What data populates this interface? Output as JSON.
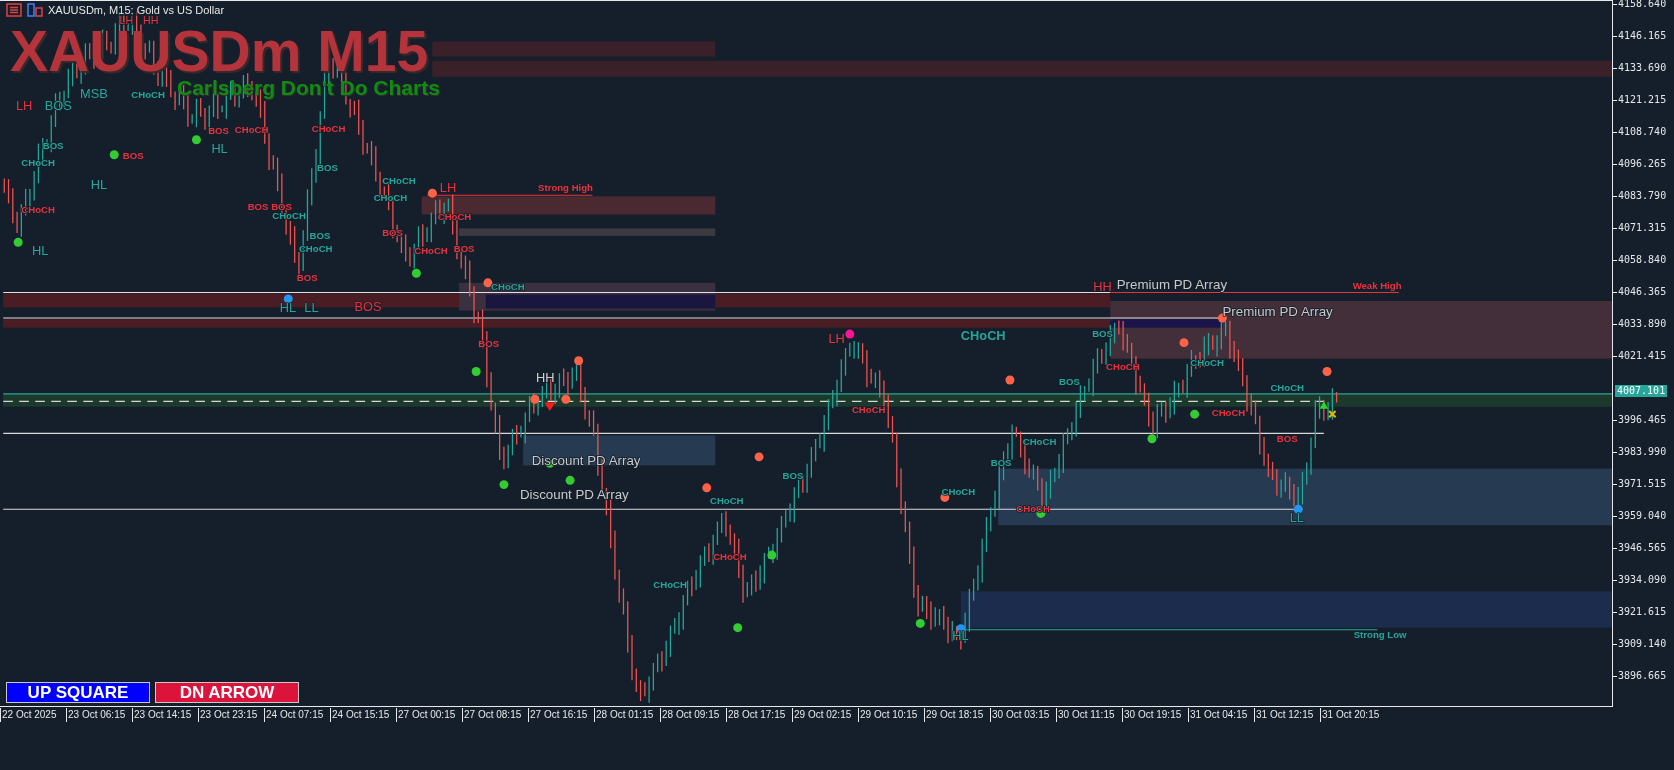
{
  "window": {
    "title": "XAUUSDm, M15: Gold vs US Dollar"
  },
  "chart": {
    "symbol_overlay": "XAUUSDm M15",
    "subtitle": "Carlsberg Don't Do Charts",
    "zone_labels": [
      {
        "text": "Strong High",
        "kind": "level",
        "color": "#e8323c"
      },
      {
        "text": "Weak High",
        "kind": "level",
        "color": "#e8323c"
      },
      {
        "text": "Premium PD Array",
        "kind": "array",
        "color": "#c8c8c8"
      },
      {
        "text": "Premium PD Array",
        "kind": "array",
        "color": "#c8c8c8"
      },
      {
        "text": "Discount PD Array",
        "kind": "array",
        "color": "#c8c8c8"
      },
      {
        "text": "Discount PD Array",
        "kind": "array",
        "color": "#c8c8c8"
      },
      {
        "text": "Strong Low",
        "kind": "level",
        "color": "#26a69a"
      }
    ],
    "structure_labels": [
      {
        "text": "LH",
        "kind": "major",
        "color": "#e8323c"
      },
      {
        "text": "BOS",
        "kind": "major",
        "color": "#26a69a"
      },
      {
        "text": "HL",
        "kind": "major",
        "color": "#26a69a"
      },
      {
        "text": "HL",
        "kind": "major",
        "color": "#26a69a"
      },
      {
        "text": "LH",
        "kind": "major",
        "color": "#e8323c"
      },
      {
        "text": "HH",
        "kind": "major",
        "color": "#e8323c"
      },
      {
        "text": "HL",
        "kind": "major",
        "color": "#26a69a"
      },
      {
        "text": "MSB",
        "kind": "major",
        "color": "#26a69a"
      },
      {
        "text": "HL",
        "kind": "major",
        "color": "#26a69a"
      },
      {
        "text": "LL",
        "kind": "major",
        "color": "#26a69a"
      },
      {
        "text": "BOS",
        "kind": "major",
        "color": "#e8323c"
      },
      {
        "text": "LH",
        "kind": "major",
        "color": "#e8323c"
      },
      {
        "text": "HH",
        "kind": "major",
        "color": "#d0d0d0"
      },
      {
        "text": "LH",
        "kind": "major",
        "color": "#e8323c"
      },
      {
        "text": "CHoCH",
        "kind": "major",
        "color": "#26a69a"
      },
      {
        "text": "HH",
        "kind": "major",
        "color": "#e8323c"
      },
      {
        "text": "LL",
        "kind": "major",
        "color": "#26a69a"
      },
      {
        "text": "HL",
        "kind": "major",
        "color": "#26a69a"
      },
      {
        "text": "BOS",
        "kind": "minor",
        "color": "#e8323c"
      },
      {
        "text": "CHoCH",
        "kind": "minor",
        "color": "#26a69a"
      },
      {
        "text": "CHoCH",
        "kind": "minor",
        "color": "#e8323c"
      },
      {
        "text": "BOS",
        "kind": "minor",
        "color": "#26a69a"
      },
      {
        "text": "CHoCH",
        "kind": "minor",
        "color": "#26a69a"
      },
      {
        "text": "BOS",
        "kind": "minor",
        "color": "#e8323c"
      },
      {
        "text": "CHoCH",
        "kind": "minor",
        "color": "#e8323c"
      },
      {
        "text": "BOS",
        "kind": "minor",
        "color": "#e8323c"
      },
      {
        "text": "BOS",
        "kind": "minor",
        "color": "#e8323c"
      },
      {
        "text": "CHoCH",
        "kind": "minor",
        "color": "#26a69a"
      },
      {
        "text": "BOS",
        "kind": "minor",
        "color": "#26a69a"
      },
      {
        "text": "CHoCH",
        "kind": "minor",
        "color": "#26a69a"
      },
      {
        "text": "BOS",
        "kind": "minor",
        "color": "#e8323c"
      },
      {
        "text": "CHoCH",
        "kind": "minor",
        "color": "#e8323c"
      },
      {
        "text": "BOS",
        "kind": "minor",
        "color": "#26a69a"
      },
      {
        "text": "CHoCH",
        "kind": "minor",
        "color": "#26a69a"
      },
      {
        "text": "BOS",
        "kind": "minor",
        "color": "#e8323c"
      },
      {
        "text": "CHoCH",
        "kind": "minor",
        "color": "#e8323c"
      },
      {
        "text": "CHoCH",
        "kind": "minor",
        "color": "#e8323c"
      },
      {
        "text": "BOS",
        "kind": "minor",
        "color": "#e8323c"
      },
      {
        "text": "CHoCH",
        "kind": "minor",
        "color": "#26a69a"
      },
      {
        "text": "CHoCH",
        "kind": "minor",
        "color": "#26a69a"
      },
      {
        "text": "BOS",
        "kind": "minor",
        "color": "#e8323c"
      },
      {
        "text": "CHoCH",
        "kind": "minor",
        "color": "#26a69a"
      },
      {
        "text": "CHoCH",
        "kind": "minor",
        "color": "#e8323c"
      },
      {
        "text": "BOS",
        "kind": "minor",
        "color": "#26a69a"
      },
      {
        "text": "CHoCH",
        "kind": "minor",
        "color": "#26a69a"
      },
      {
        "text": "CHoCH",
        "kind": "minor",
        "color": "#e8323c"
      },
      {
        "text": "CHoCH",
        "kind": "minor",
        "color": "#26a69a"
      },
      {
        "text": "BOS",
        "kind": "minor",
        "color": "#26a69a"
      },
      {
        "text": "CHoCH",
        "kind": "minor",
        "color": "#26a69a"
      },
      {
        "text": "BOS",
        "kind": "minor",
        "color": "#26a69a"
      },
      {
        "text": "BOS",
        "kind": "minor",
        "color": "#26a69a"
      },
      {
        "text": "CHoCH",
        "kind": "minor",
        "color": "#e8323c"
      },
      {
        "text": "CHoCH",
        "kind": "minor",
        "color": "#26a69a"
      },
      {
        "text": "CHoCH",
        "kind": "minor",
        "color": "#e8323c"
      },
      {
        "text": "CHoCH",
        "kind": "minor",
        "color": "#26a69a"
      },
      {
        "text": "BOS",
        "kind": "minor",
        "color": "#e8323c"
      },
      {
        "text": "CHoCH",
        "kind": "minor",
        "color": "#e8323c"
      }
    ],
    "swing_points": [
      {
        "color": "#ff6347"
      },
      {
        "color": "#ff6347"
      },
      {
        "color": "#ff6347"
      },
      {
        "color": "#ff6347"
      },
      {
        "color": "#ff6347"
      },
      {
        "color": "#ff6347"
      },
      {
        "color": "#ff6347"
      },
      {
        "color": "#ff6347"
      },
      {
        "color": "#ff6347"
      },
      {
        "color": "#ff6347"
      },
      {
        "color": "#ff6347"
      },
      {
        "color": "#ff6347"
      },
      {
        "color": "#33cc33"
      },
      {
        "color": "#33cc33"
      },
      {
        "color": "#33cc33"
      },
      {
        "color": "#33cc33"
      },
      {
        "color": "#33cc33"
      },
      {
        "color": "#33cc33"
      },
      {
        "color": "#33cc33"
      },
      {
        "color": "#33cc33"
      },
      {
        "color": "#33cc33"
      },
      {
        "color": "#33cc33"
      },
      {
        "color": "#33cc33"
      },
      {
        "color": "#33cc33"
      },
      {
        "color": "#33cc33"
      },
      {
        "color": "#33cc33"
      },
      {
        "color": "#2196f3"
      },
      {
        "color": "#2196f3"
      },
      {
        "color": "#2196f3"
      },
      {
        "color": "#ff1493"
      }
    ],
    "price_axis": [
      "4158.640",
      "4146.165",
      "4133.690",
      "4121.215",
      "4108.740",
      "4096.265",
      "4083.790",
      "4071.315",
      "4058.840",
      "4046.365",
      "4033.890",
      "4021.415",
      "3996.465",
      "3983.990",
      "3971.515",
      "3959.040",
      "3946.565",
      "3934.090",
      "3921.615",
      "3909.140",
      "3896.665"
    ],
    "current_price": "4007.101",
    "time_axis": [
      "22 Oct 2025",
      "23 Oct 06:15",
      "23 Oct 14:15",
      "23 Oct 23:15",
      "24 Oct 07:15",
      "24 Oct 15:15",
      "27 Oct 00:15",
      "27 Oct 08:15",
      "27 Oct 16:15",
      "28 Oct 01:15",
      "28 Oct 09:15",
      "28 Oct 17:15",
      "29 Oct 02:15",
      "29 Oct 10:15",
      "29 Oct 18:15",
      "30 Oct 03:15",
      "30 Oct 11:15",
      "30 Oct 19:15",
      "31 Oct 04:15",
      "31 Oct 12:15",
      "31 Oct 20:15"
    ]
  },
  "buttons": [
    {
      "label": "UP SQUARE",
      "color": "#0000ff"
    },
    {
      "label": "DN ARROW",
      "color": "#dc143c"
    }
  ]
}
